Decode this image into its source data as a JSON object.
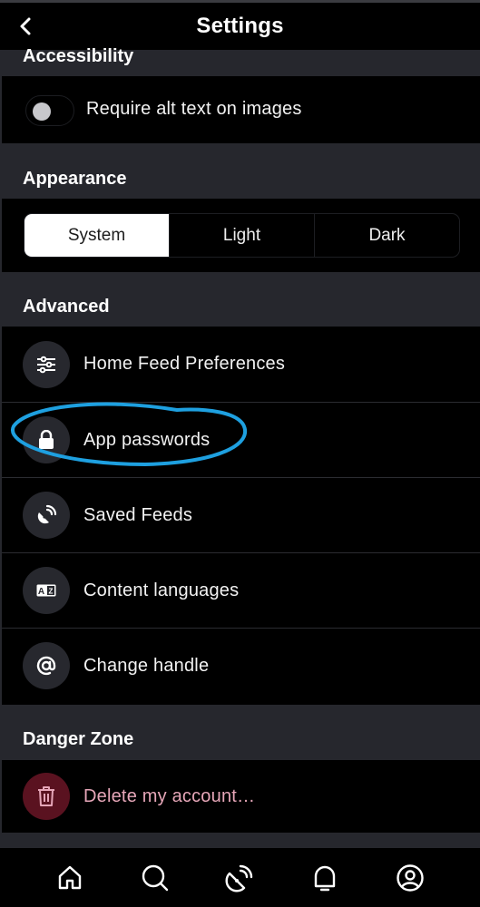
{
  "header": {
    "title": "Settings",
    "back_icon": "chevron-left-icon"
  },
  "accessibility": {
    "heading": "Accessibility",
    "require_alt_text": {
      "label": "Require alt text on images",
      "enabled": false
    }
  },
  "appearance": {
    "heading": "Appearance",
    "options": [
      "System",
      "Light",
      "Dark"
    ],
    "selected": "System"
  },
  "advanced": {
    "heading": "Advanced",
    "items": [
      {
        "label": "Home Feed Preferences",
        "icon": "sliders-icon"
      },
      {
        "label": "App passwords",
        "icon": "lock-icon",
        "annotated": true
      },
      {
        "label": "Saved Feeds",
        "icon": "satellite-dish-icon"
      },
      {
        "label": "Content languages",
        "icon": "language-icon"
      },
      {
        "label": "Change handle",
        "icon": "at-sign-icon"
      }
    ]
  },
  "danger": {
    "heading": "Danger Zone",
    "delete_label": "Delete my account…",
    "delete_icon": "trash-icon",
    "color": "#e6a6b8",
    "icon_bg": "#5a1220"
  },
  "annotation": {
    "color": "#1ea0e0"
  },
  "tabbar": {
    "tabs": [
      {
        "name": "home",
        "icon": "home-icon"
      },
      {
        "name": "search",
        "icon": "search-icon"
      },
      {
        "name": "feeds",
        "icon": "satellite-dish-icon"
      },
      {
        "name": "notifications",
        "icon": "bell-icon"
      },
      {
        "name": "profile",
        "icon": "user-circle-icon"
      }
    ]
  }
}
